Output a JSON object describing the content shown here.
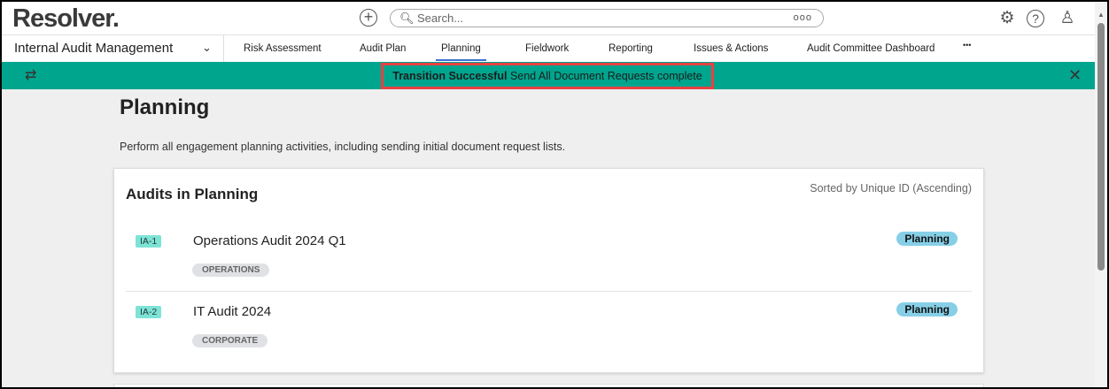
{
  "header": {
    "logo": "Resolver.",
    "search_placeholder": "Search...",
    "search_icon": "search-icon",
    "more": "ooo"
  },
  "nav": {
    "app": "Internal Audit Management",
    "tabs": [
      "Risk Assessment",
      "Audit Plan",
      "Planning",
      "Fieldwork",
      "Reporting",
      "Issues & Actions",
      "Audit Committee Dashboard"
    ],
    "more": "•••",
    "active": "Planning"
  },
  "banner": {
    "bold": "Transition Successful",
    "text": " Send All Document Requests complete",
    "color": "#00a58e"
  },
  "page": {
    "title": "Planning",
    "description": "Perform all engagement planning activities, including sending initial document request lists."
  },
  "card": {
    "title": "Audits in Planning",
    "sorted": "Sorted by Unique ID (Ascending)",
    "items": [
      {
        "id": "IA-1",
        "name": "Operations Audit 2024 Q1",
        "category": "OPERATIONS",
        "status": "Planning"
      },
      {
        "id": "IA-2",
        "name": "IT Audit 2024",
        "category": "CORPORATE",
        "status": "Planning"
      }
    ]
  }
}
